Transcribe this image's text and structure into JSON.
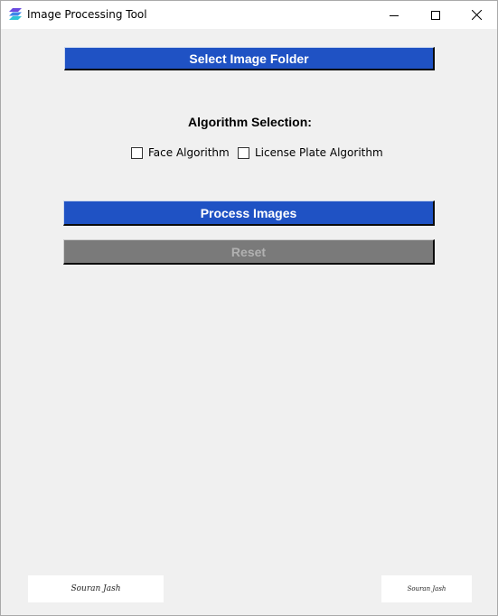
{
  "window": {
    "title": "Image Processing Tool",
    "icon": "stacked-layers-icon",
    "controls": {
      "minimize": "minimize-icon",
      "maximize": "maximize-icon",
      "close": "close-icon"
    }
  },
  "main": {
    "select_folder_label": "Select Image Folder",
    "algorithm_heading": "Algorithm Selection:",
    "algorithms": [
      {
        "label": "Face Algorithm",
        "checked": false
      },
      {
        "label": "License Plate Algorithm",
        "checked": false
      }
    ],
    "process_label": "Process Images",
    "reset_label": "Reset",
    "reset_enabled": false
  },
  "footer": {
    "signature_left": "Souran Jash",
    "signature_right": "Souran Jash"
  },
  "colors": {
    "background": "#f0f0f0",
    "primary_button": "#1f52c4",
    "disabled_button": "#7a7a7a",
    "disabled_text": "#b1b1b1"
  }
}
